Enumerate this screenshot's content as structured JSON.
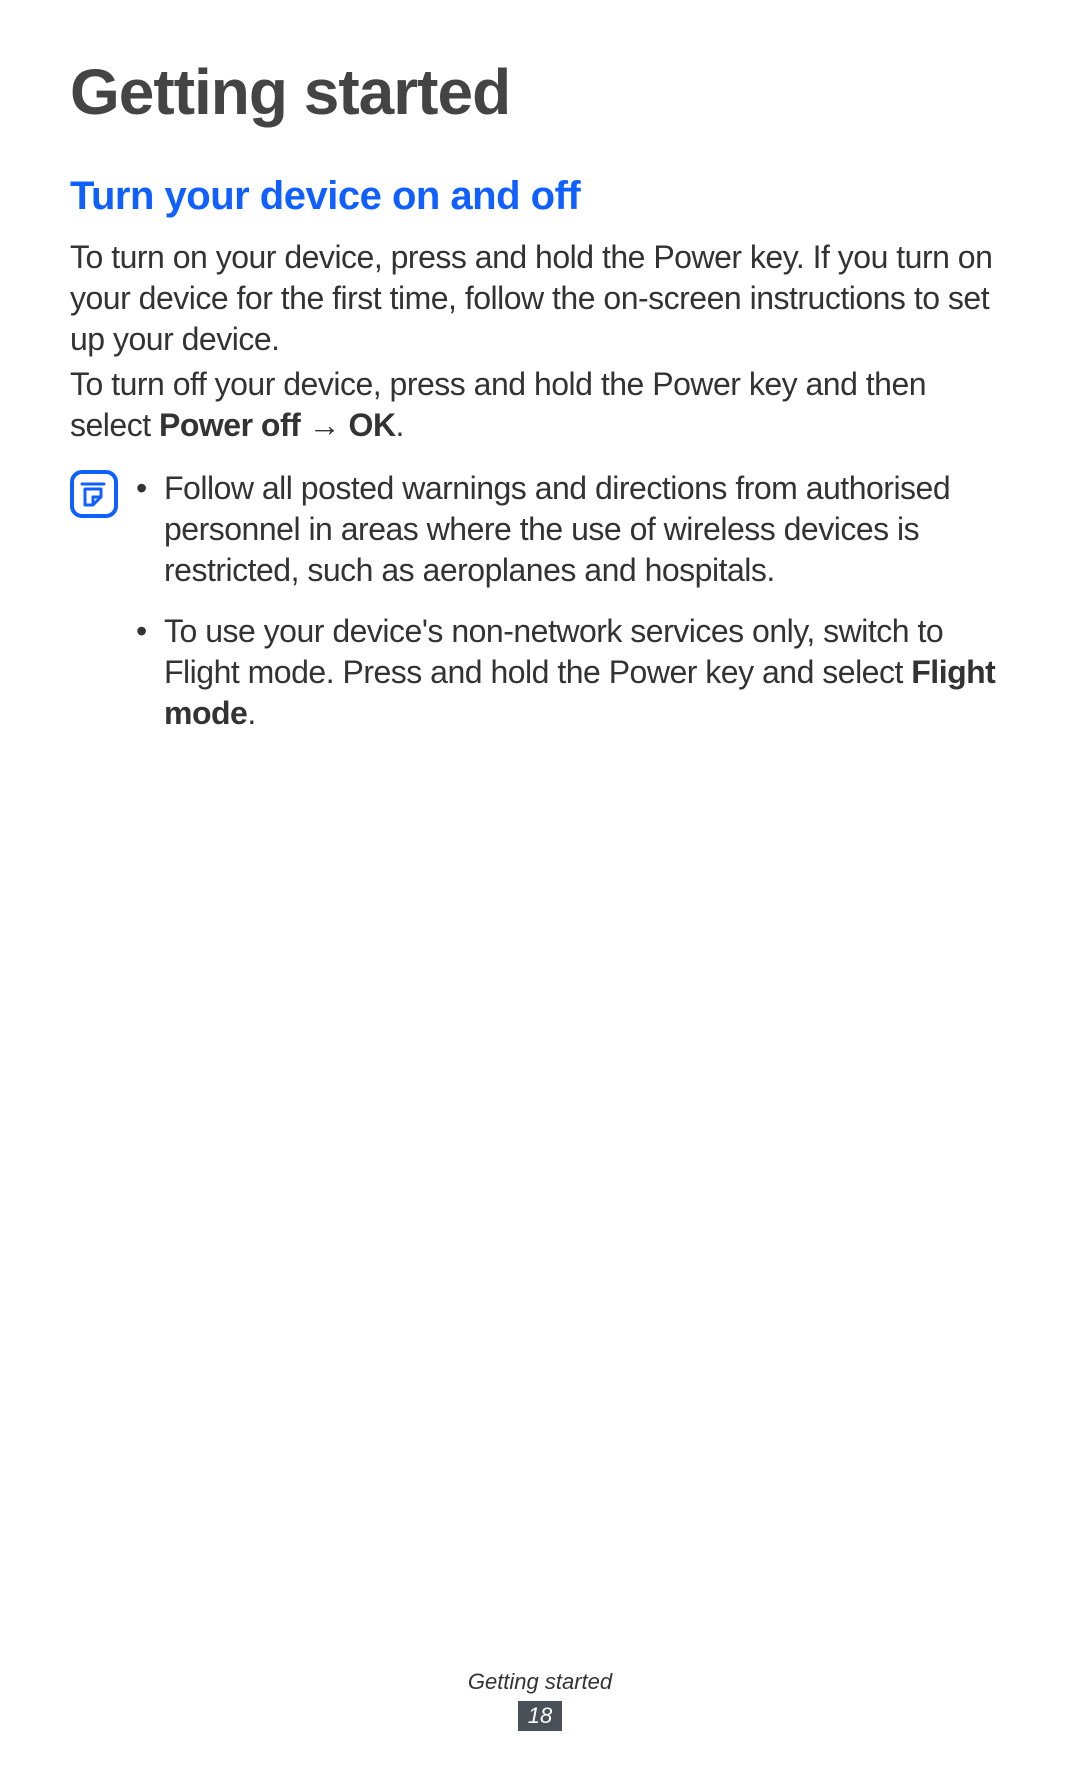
{
  "page": {
    "title": "Getting started",
    "footer_title": "Getting started",
    "footer_page": "18"
  },
  "section": {
    "heading": "Turn your device on and off",
    "para1": "To turn on your device, press and hold the Power key. If you turn on your device for the first time, follow the on-screen instructions to set up your device.",
    "para2_pre": "To turn off your device, press and hold the Power key and then select ",
    "para2_bold1": "Power off",
    "para2_arrow": " → ",
    "para2_bold2": "OK",
    "para2_post": "."
  },
  "note": {
    "icon_name": "note-icon",
    "item1": "Follow all posted warnings and directions from authorised personnel in areas where the use of wireless devices is restricted, such as aeroplanes and hospitals.",
    "item2_pre": "To use your device's non-network services only, switch to Flight mode. Press and hold the Power key and select ",
    "item2_bold": "Flight mode",
    "item2_post": "."
  }
}
